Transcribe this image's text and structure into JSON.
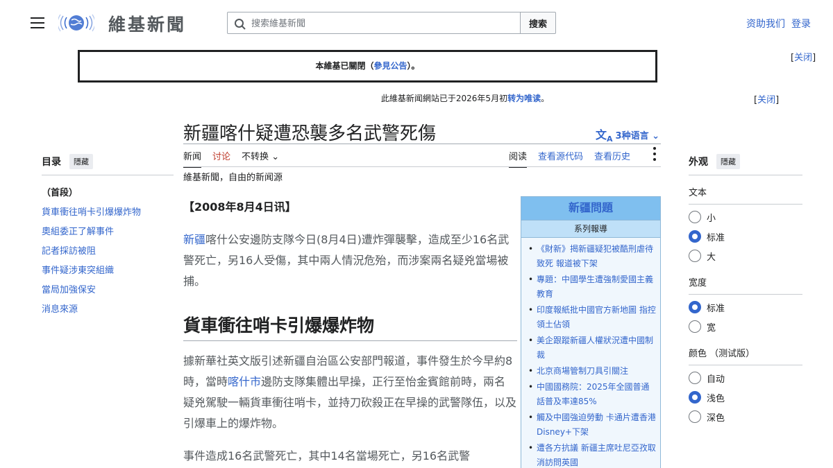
{
  "header": {
    "wordmark": "維基新聞",
    "search_placeholder": "搜索維基新聞",
    "search_button": "搜索",
    "donate": "资助我们",
    "login": "登录"
  },
  "notice": {
    "text_pre": "本維基已關閉（",
    "link": "參見公告",
    "text_post": "）。",
    "close_open": "[",
    "close_label": "关闭",
    "close_end": "]"
  },
  "sitenotice": {
    "text_pre": "此維基新闻網站已于2026年5月初",
    "link": "转为唯读",
    "text_post": "。",
    "close_label": "关闭"
  },
  "page": {
    "title": "新疆喀什疑遭恐襲多名武警死傷",
    "languages": "3种语言",
    "tagline": "維基新聞，自由的新闻源"
  },
  "tabs": {
    "news": "新闻",
    "talk": "讨论",
    "variant": "不转换",
    "read": "阅读",
    "view_source": "查看源代码",
    "history": "查看历史"
  },
  "toc": {
    "title": "目录",
    "hide": "隱藏",
    "items": [
      "（首段）",
      "貨車衝往哨卡引爆爆炸物",
      "奧組委正了解事件",
      "記者採訪被阻",
      "事件疑涉東突組織",
      "當局加強保安",
      "消息來源"
    ]
  },
  "article": {
    "dateline": "【2008年8月4日讯】",
    "p1_link": "新疆",
    "p1_text": "喀什公安邊防支隊今日(8月4日)遭炸彈襲擊，造成至少16名武警死亡，另16人受傷，其中兩人情況危殆，而涉案兩名疑兇當場被捕。",
    "h2": "貨車衝往哨卡引爆爆炸物",
    "p2_a": "據新華社英文版引述新疆自治區公安部門報道，事件發生於今早約8時，當時",
    "p2_link": "喀什市",
    "p2_b": "邊防支隊集體出早操，正行至怡金賓館前時，兩名疑兇駕駛一輛貨車衝往哨卡，並持刀砍殺正在早操的武警隊伍，以及引爆車上的爆炸物。",
    "p3": "事件造成16名武警死亡，其中14名當場死亡，另16名武警"
  },
  "infobox": {
    "title": "新疆問題",
    "subtitle": "系列報導",
    "items": [
      "《財新》揭新疆疑犯被酷刑虐待致死 報道被下架",
      "專題：中國學生遭強制愛國主義教育",
      "印度報紙批中國官方新地圖 指控領土佔領",
      "美企跟蹤新疆人權狀況遭中國制裁",
      "北京商場管制刀具引關注",
      "中國國務院：2025年全國普通話普及率達85%",
      "觸及中國強迫勞動 卡通片遭香港Disney+下架",
      "遭各方抗議 新疆主席吐尼亞孜取消訪問英國"
    ]
  },
  "appearance": {
    "title": "外观",
    "hide": "隱藏",
    "text_label": "文本",
    "text_options": [
      "小",
      "标准",
      "大"
    ],
    "text_selected": 1,
    "width_label": "宽度",
    "width_options": [
      "标准",
      "宽"
    ],
    "width_selected": 0,
    "color_label": "颜色 （测试版）",
    "color_options": [
      "自动",
      "浅色",
      "深色"
    ],
    "color_selected": 1
  }
}
